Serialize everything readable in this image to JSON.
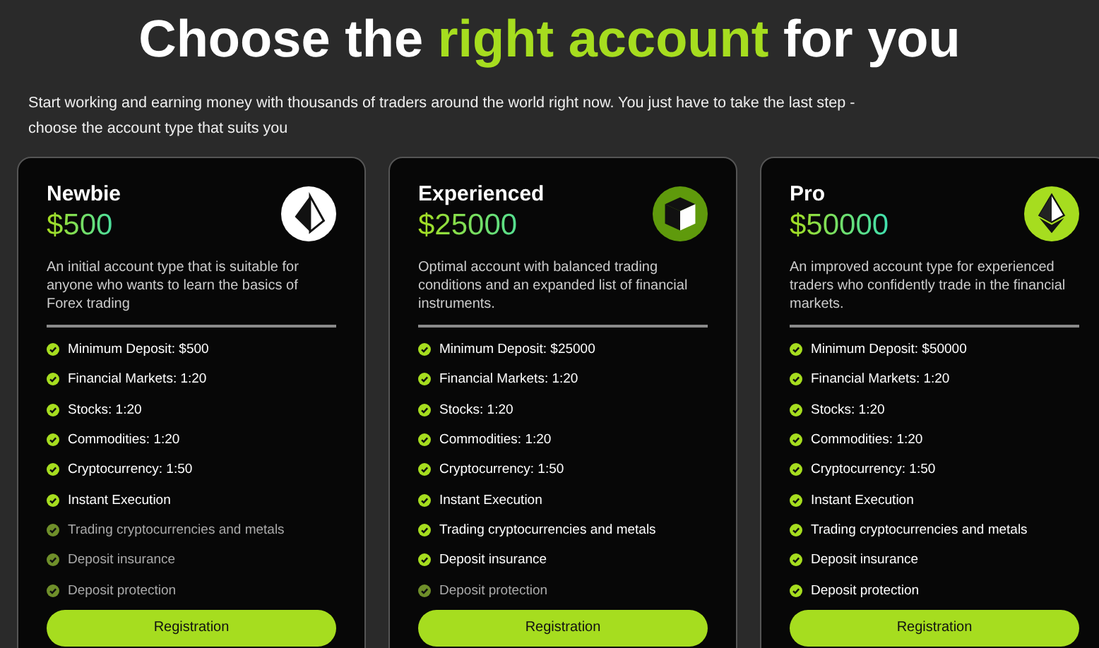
{
  "title": [
    {
      "text": "Choose the ",
      "highlight": false
    },
    {
      "text": "right account",
      "highlight": true
    },
    {
      "text": " for you",
      "highlight": false
    }
  ],
  "subtitle": "Start working and earning money with thousands of traders around the world right now. You just have to take the last step - choose the account type that suits you",
  "plans": [
    {
      "name": "Newbie",
      "price": "$500",
      "description": "An initial account type that is suitable for anyone who wants to learn the basics of Forex trading",
      "features": [
        {
          "text": "Minimum Deposit: $500",
          "available": true
        },
        {
          "text": "Financial Markets: 1:20",
          "available": true
        },
        {
          "text": "Stocks: 1:20",
          "available": true
        },
        {
          "text": "Commodities: 1:20",
          "available": true
        },
        {
          "text": "Cryptocurrency: 1:50",
          "available": true
        },
        {
          "text": "Instant Execution",
          "available": true
        },
        {
          "text": "Trading cryptocurrencies and metals",
          "available": false
        },
        {
          "text": "Deposit insurance",
          "available": false
        },
        {
          "text": "Deposit protection",
          "available": false
        }
      ],
      "button": "Registration"
    },
    {
      "name": "Experienced",
      "price": "$25000",
      "description": "Optimal account with balanced trading conditions and an expanded list of financial instruments.",
      "features": [
        {
          "text": "Minimum Deposit: $25000",
          "available": true
        },
        {
          "text": "Financial Markets: 1:20",
          "available": true
        },
        {
          "text": "Stocks: 1:20",
          "available": true
        },
        {
          "text": "Commodities: 1:20",
          "available": true
        },
        {
          "text": "Cryptocurrency: 1:50",
          "available": true
        },
        {
          "text": "Instant Execution",
          "available": true
        },
        {
          "text": "Trading cryptocurrencies and metals",
          "available": true
        },
        {
          "text": "Deposit insurance",
          "available": true
        },
        {
          "text": "Deposit protection",
          "available": false
        }
      ],
      "button": "Registration"
    },
    {
      "name": "Pro",
      "price": "$50000",
      "description": "An improved account type for experienced traders who confidently trade in the financial markets.",
      "features": [
        {
          "text": "Minimum Deposit: $50000",
          "available": true
        },
        {
          "text": "Financial Markets: 1:20",
          "available": true
        },
        {
          "text": "Stocks: 1:20",
          "available": true
        },
        {
          "text": "Commodities: 1:20",
          "available": true
        },
        {
          "text": "Cryptocurrency: 1:50",
          "available": true
        },
        {
          "text": "Instant Execution",
          "available": true
        },
        {
          "text": "Trading cryptocurrencies and metals",
          "available": true
        },
        {
          "text": "Deposit insurance",
          "available": true
        },
        {
          "text": "Deposit protection",
          "available": true
        }
      ],
      "button": "Registration"
    }
  ]
}
